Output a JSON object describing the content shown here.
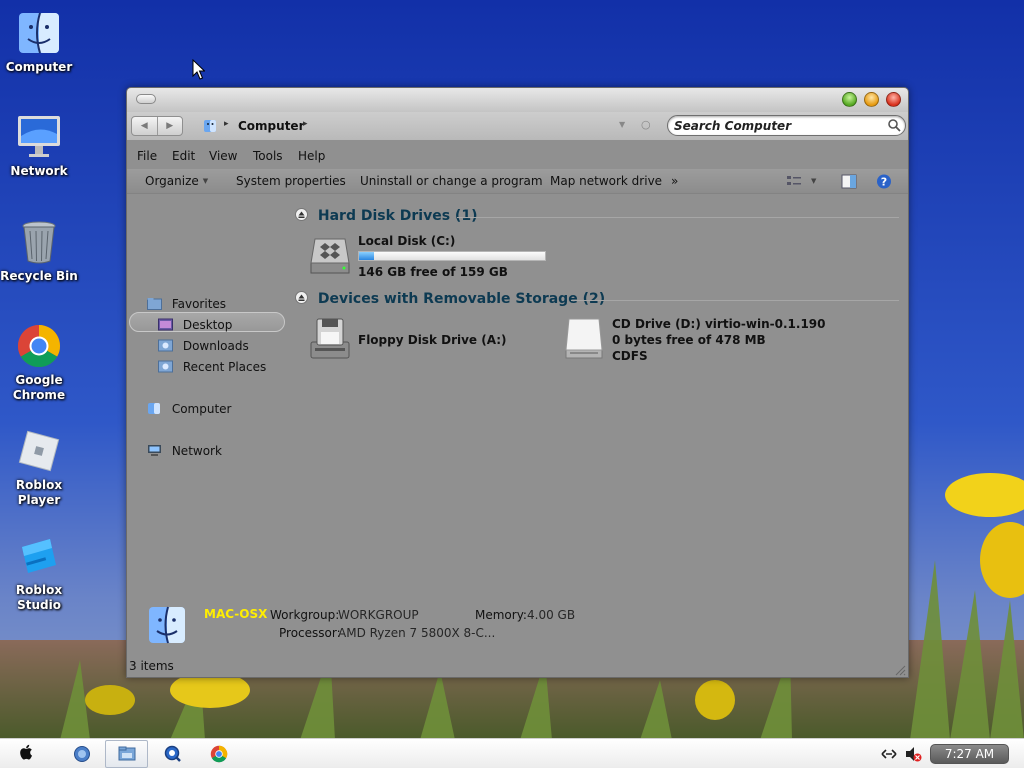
{
  "desktop": {
    "icons": [
      {
        "label": "Computer",
        "icon": "mac-finder-icon"
      },
      {
        "label": "Network",
        "icon": "imac-icon"
      },
      {
        "label": "Recycle Bin",
        "icon": "trash-can-icon"
      },
      {
        "label": "Google Chrome",
        "icon": "chrome-icon"
      },
      {
        "label": "Roblox Player",
        "icon": "roblox-player-icon"
      },
      {
        "label": "Roblox Studio",
        "icon": "roblox-studio-icon"
      }
    ]
  },
  "window": {
    "address": {
      "back": "◀",
      "forward": "▶",
      "location": "Computer",
      "separator": "▸",
      "dropdown": "▼",
      "refresh": "○"
    },
    "search": {
      "placeholder": "Search Computer"
    },
    "menu": [
      "File",
      "Edit",
      "View",
      "Tools",
      "Help"
    ],
    "toolbar": {
      "organize": "Organize",
      "system_properties": "System properties",
      "uninstall": "Uninstall or change a program",
      "map_drive": "Map network drive",
      "more": "»",
      "dropdown": "▼"
    },
    "nav": {
      "favorites": "Favorites",
      "desktop": "Desktop",
      "downloads": "Downloads",
      "recent": "Recent Places",
      "computer": "Computer",
      "network": "Network"
    },
    "groups": {
      "hdd_title": "Hard Disk Drives (1)",
      "removable_title": "Devices with Removable Storage (2)"
    },
    "drives": {
      "local": {
        "name": "Local Disk (C:)",
        "free_text": "146 GB free of 159 GB",
        "used_fraction": 0.08
      },
      "floppy": {
        "name": "Floppy Disk Drive (A:)"
      },
      "cd": {
        "name": "CD Drive (D:) virtio-win-0.1.190",
        "free_text": "0 bytes free of 478 MB",
        "fs": "CDFS"
      }
    },
    "details": {
      "computer_name": "MAC-OSX",
      "workgroup_label": "Workgroup:",
      "workgroup_value": "WORKGROUP",
      "memory_label": "Memory:",
      "memory_value": "4.00 GB",
      "processor_label": "Processor:",
      "processor_value": "AMD Ryzen 7 5800X 8-C..."
    },
    "status": {
      "items": "3 items"
    }
  },
  "taskbar": {
    "clock": "7:27 AM",
    "apps": [
      "apple-icon",
      "finder-icon",
      "explorer-icon",
      "quicktime-icon",
      "chrome-icon"
    ]
  },
  "colors": {
    "window_bg": "#909090",
    "group_heading": "#0d3a52",
    "computer_name": "#ffee00"
  }
}
